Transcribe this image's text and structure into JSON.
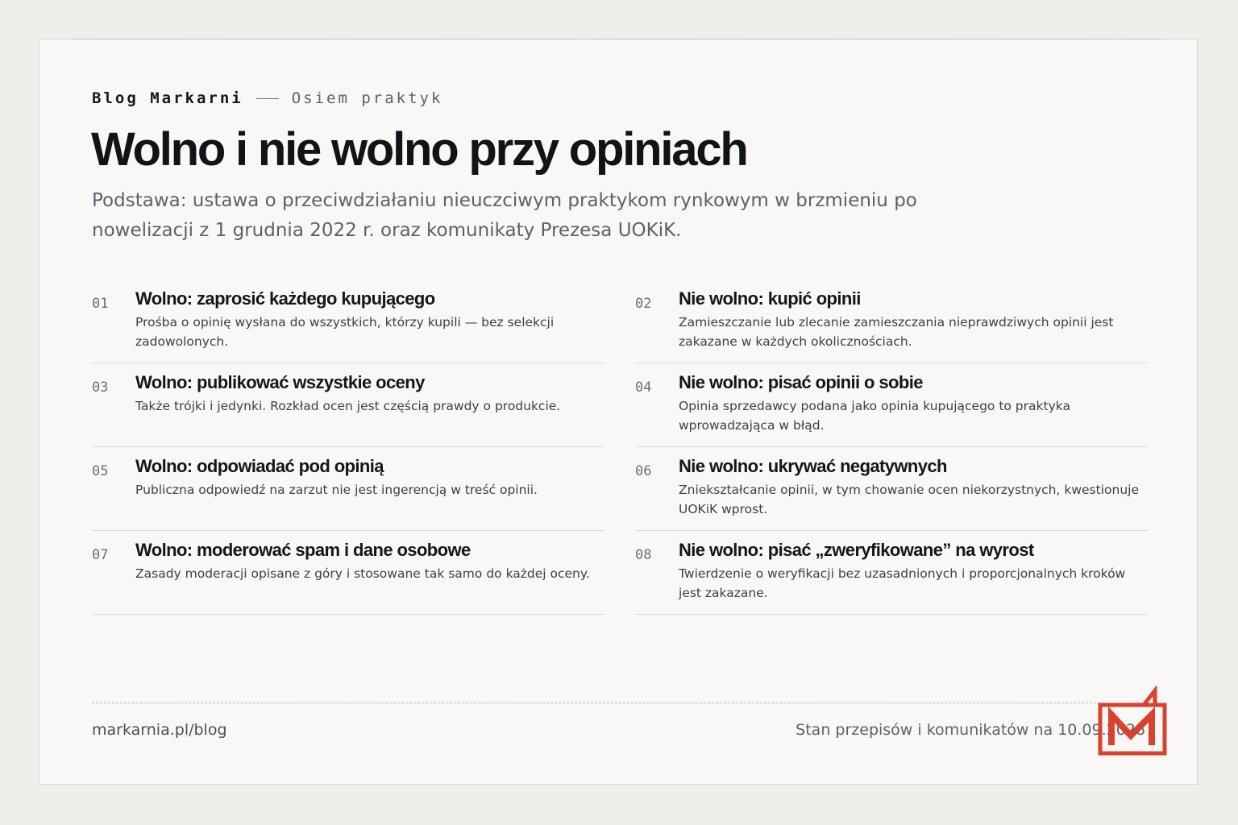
{
  "header": {
    "blog": "Blog Markarni",
    "series": "Osiem praktyk"
  },
  "title": "Wolno i nie wolno przy opiniach",
  "lede": "Podstawa: ustawa o przeciwdziałaniu nieuczciwym praktykom rynkowym w brzmieniu po nowelizacji z 1 grudnia 2022 r. oraz komunikaty Prezesa UOKiK.",
  "items": [
    {
      "num": "01",
      "title": "Wolno: zaprosić każdego kupującego",
      "desc": "Prośba o opinię wysłana do wszystkich, którzy kupili — bez selekcji zadowolonych."
    },
    {
      "num": "02",
      "title": "Nie wolno: kupić opinii",
      "desc": "Zamieszczanie lub zlecanie zamieszczania nieprawdziwych opinii jest zakazane w każdych okolicznościach."
    },
    {
      "num": "03",
      "title": "Wolno: publikować wszystkie oceny",
      "desc": "Także trójki i jedynki. Rozkład ocen jest częścią prawdy o produkcie."
    },
    {
      "num": "04",
      "title": "Nie wolno: pisać opinii o sobie",
      "desc": "Opinia sprzedawcy podana jako opinia kupującego to praktyka wprowadzająca w błąd."
    },
    {
      "num": "05",
      "title": "Wolno: odpowiadać pod opinią",
      "desc": "Publiczna odpowiedź na zarzut nie jest ingerencją w treść opinii."
    },
    {
      "num": "06",
      "title": "Nie wolno: ukrywać negatywnych",
      "desc": "Zniekształcanie opinii, w tym chowanie ocen niekorzystnych, kwestionuje UOKiK wprost."
    },
    {
      "num": "07",
      "title": "Wolno: moderować spam i dane osobowe",
      "desc": "Zasady moderacji opisane z góry i stosowane tak samo do każdej oceny."
    },
    {
      "num": "08",
      "title": "Nie wolno: pisać „zweryfikowane” na wyrost",
      "desc": "Twierdzenie o weryfikacji bez uzasadnionych i proporcjonalnych kroków jest zakazane."
    }
  ],
  "footer": {
    "url": "markarnia.pl/blog",
    "status": "Stan przepisów i komunikatów na 10.09.2026"
  },
  "logo": {
    "icon": "markarnia-m-logo",
    "color": "#d8432f"
  },
  "colors": {
    "page_bg": "#efeeeb",
    "card_bg": "#f9f8f6",
    "text": "#14161a",
    "muted": "#5d6167"
  }
}
